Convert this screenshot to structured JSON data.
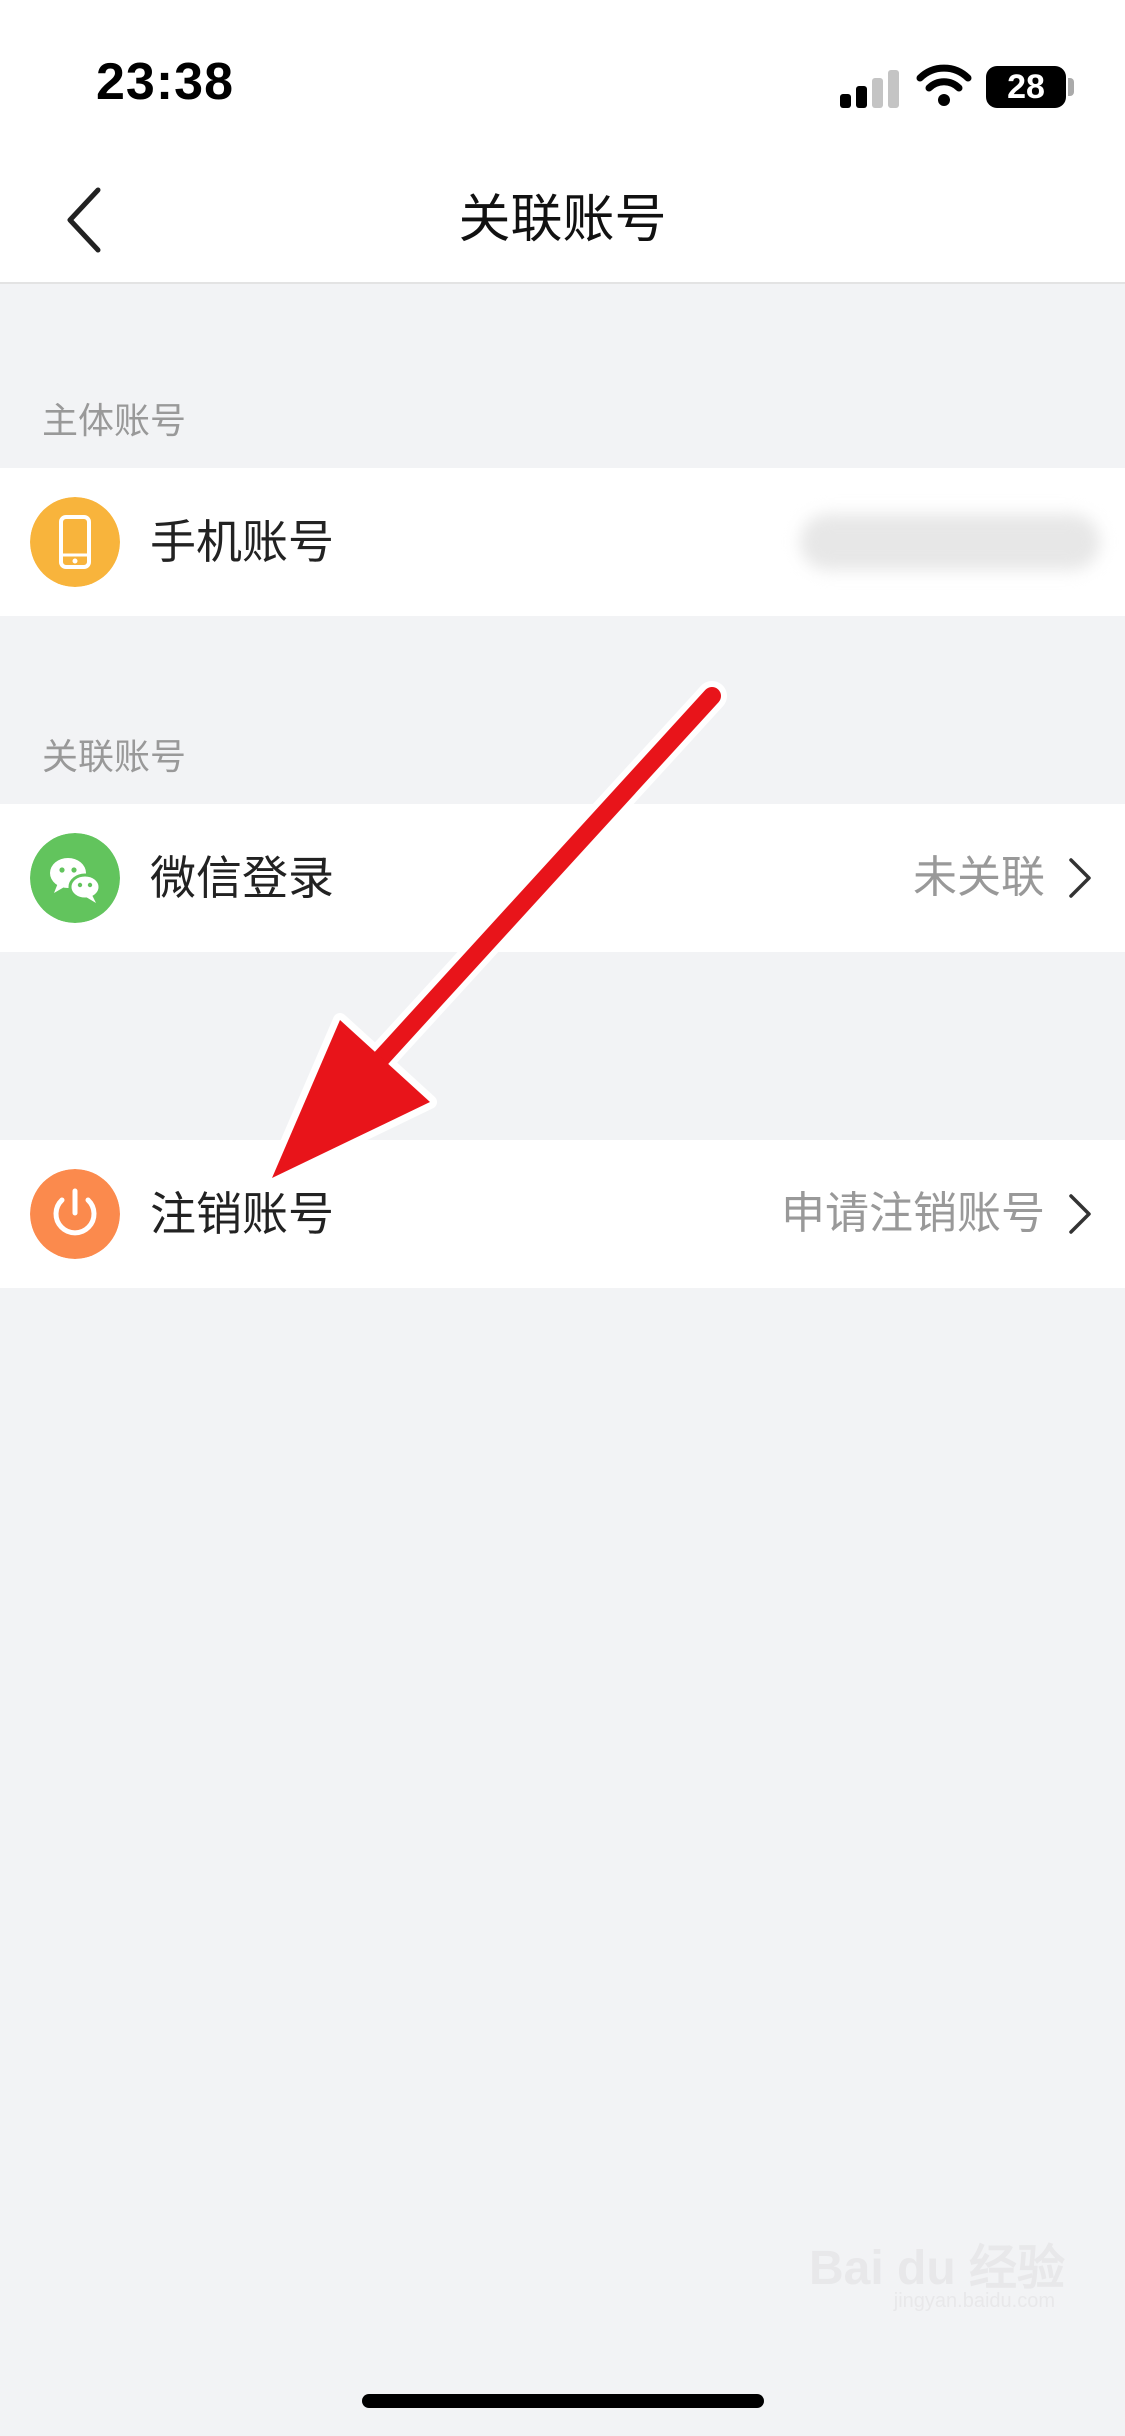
{
  "status_bar": {
    "time": "23:38",
    "battery": "28"
  },
  "nav": {
    "title": "关联账号",
    "back_icon": "chevron-left-icon"
  },
  "sections": {
    "main_label": "主体账号",
    "linked_label": "关联账号"
  },
  "rows": {
    "phone": {
      "label": "手机账号",
      "icon": "phone-icon",
      "icon_color": "#f8b43c"
    },
    "wechat": {
      "label": "微信登录",
      "value": "未关联",
      "icon": "wechat-icon",
      "icon_color": "#62c45d"
    },
    "cancel": {
      "label": "注销账号",
      "value": "申请注销账号",
      "icon": "power-icon",
      "icon_color": "#fb8a4d"
    }
  },
  "annotation": {
    "arrow_color": "#e8141a"
  },
  "watermark": {
    "brand": "Bai du 经验",
    "url": "jingyan.baidu.com"
  }
}
